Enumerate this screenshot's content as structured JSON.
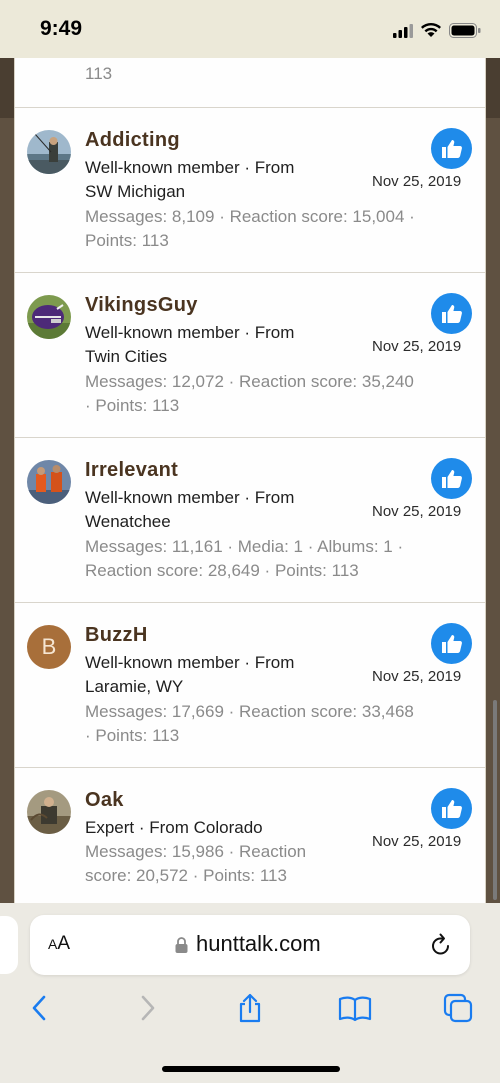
{
  "status_bar": {
    "time": "9:49"
  },
  "partial_row": {
    "points": "113"
  },
  "members": [
    {
      "username": "Addicting",
      "title": "Well-known member · From",
      "location": "SW Michigan",
      "stats_line1": "Messages: 8,109 · Reaction score: 15,004 ·",
      "stats_line2": "Points: 113",
      "date": "Nov 25, 2019"
    },
    {
      "username": "VikingsGuy",
      "title": "Well-known member · From",
      "location": "Twin Cities",
      "stats_line1": "Messages: 12,072 · Reaction score: 35,240",
      "stats_line2": "· Points: 113",
      "date": "Nov 25, 2019"
    },
    {
      "username": "Irrelevant",
      "title": "Well-known member · From",
      "location": "Wenatchee",
      "stats_line1": "Messages: 11,161 · Media: 1 · Albums: 1 ·",
      "stats_line2": "Reaction score: 28,649 · Points: 113",
      "date": "Nov 25, 2019"
    },
    {
      "username": "BuzzH",
      "avatar_letter": "B",
      "title": "Well-known member · From",
      "location": "Laramie, WY",
      "stats_line1": "Messages: 17,669 · Reaction score: 33,468",
      "stats_line2": "· Points: 113",
      "date": "Nov 25, 2019"
    },
    {
      "username": "Oak",
      "title": "Expert · From Colorado",
      "stats_line1": "Messages: 15,986 · Reaction",
      "stats_line2": "score: 20,572 · Points: 113",
      "date": "Nov 25, 2019"
    }
  ],
  "browser": {
    "reader_label": "AA",
    "url": "hunttalk.com",
    "icons": [
      "lock-icon",
      "reload-icon",
      "back-icon",
      "forward-icon",
      "share-icon",
      "bookmarks-icon",
      "tabs-icon"
    ]
  },
  "colors": {
    "like_button": "#1f8bea",
    "username": "#4a3420",
    "accent_safari": "#1a7cf0"
  }
}
